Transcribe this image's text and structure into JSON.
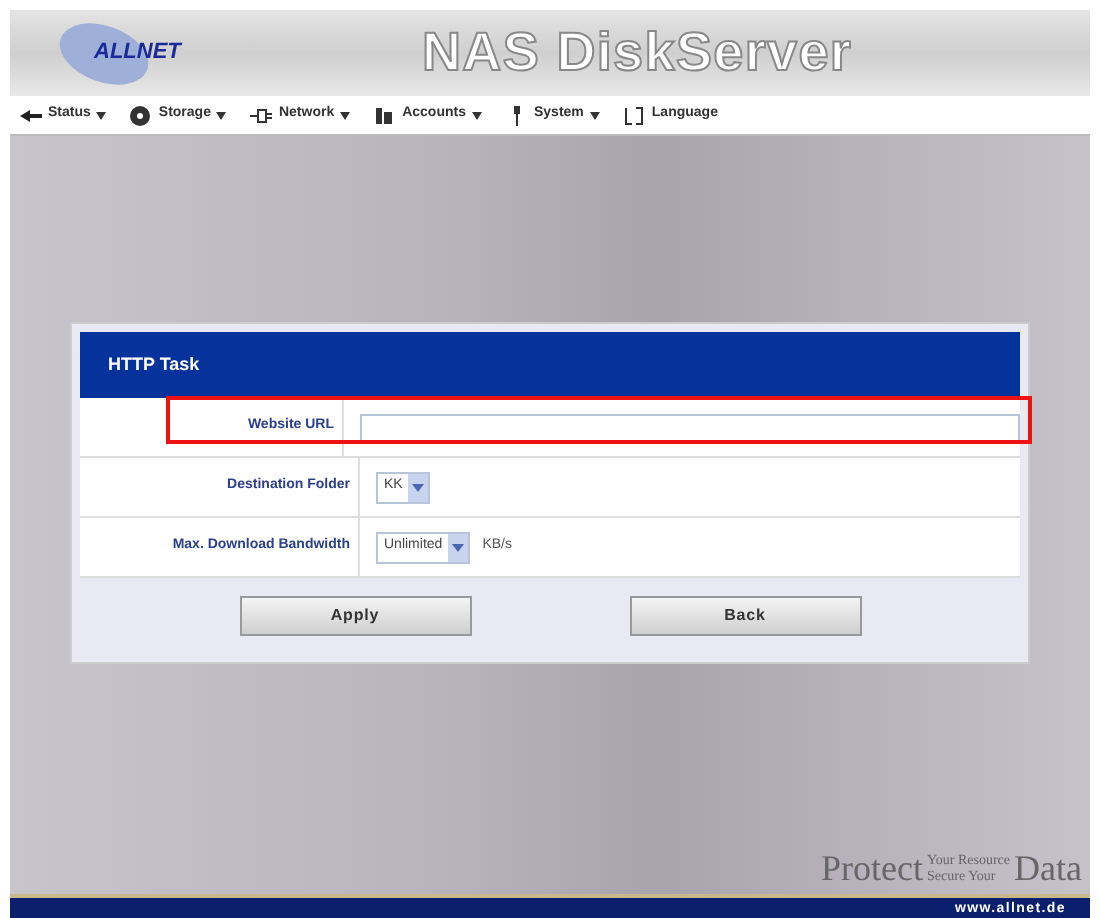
{
  "header": {
    "logo": "ALLNET",
    "title": "NAS DiskServer"
  },
  "nav": [
    {
      "label": "Status",
      "menu": true
    },
    {
      "label": "Storage",
      "menu": true
    },
    {
      "label": "Network",
      "menu": true
    },
    {
      "label": "Accounts",
      "menu": true
    },
    {
      "label": "System",
      "menu": true
    },
    {
      "label": "Language",
      "menu": false
    }
  ],
  "panel": {
    "title": "HTTP Task",
    "rows": [
      {
        "kind": "text",
        "label": "Website URL",
        "highlighted": true
      },
      {
        "kind": "select",
        "label": "Destination Folder",
        "value": "KK",
        "highlighted": false
      },
      {
        "kind": "select",
        "label": "Max. Download Bandwidth",
        "value": "Unlimited",
        "unit": "KB/s",
        "highlighted": false
      }
    ],
    "buttons": [
      "Apply",
      "Back"
    ]
  },
  "footer": {
    "slogan": [
      "Protect",
      "Your Resource",
      "Secure Your",
      "Data"
    ],
    "url": "www.allnet.de"
  }
}
